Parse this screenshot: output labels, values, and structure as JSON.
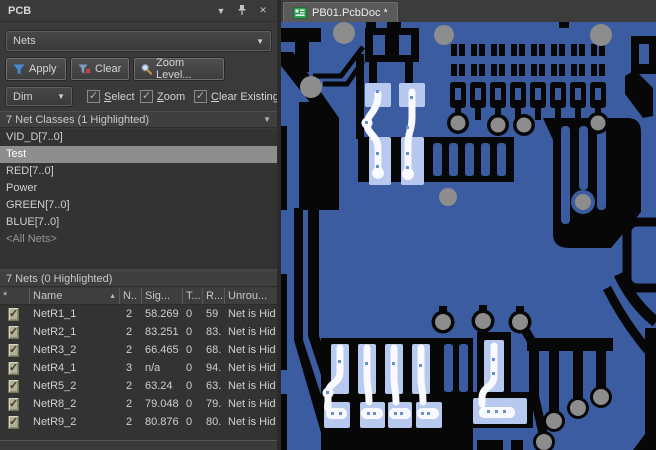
{
  "theme": {
    "panel_bg": "#3a3a3a",
    "panel_text": "#d2d2d2",
    "control_bg": "#454545",
    "control_border": "#6a6a6a",
    "field_bg": "#343434",
    "list_bg": "#333333",
    "header_bg": "#3f3f3f",
    "row_highlight": "#8e8e8e",
    "dim_text": "#969696",
    "table_check_bg": "#b3b196",
    "accent_blue": "#4a8ad4",
    "danger_red": "#d04545",
    "pcb_blue": "#3c5ca2",
    "pcb_black": "#070707",
    "via_gray": "#8d8d8d",
    "hl_pad": "#b7c9ee",
    "hl_trace": "#f8faff",
    "tab_bg": "#3c3c3c",
    "tab_active": "#5a5a5a"
  },
  "panel": {
    "title": "PCB",
    "mode_select": {
      "value": "Nets"
    },
    "buttons": {
      "apply": "Apply",
      "clear": "Clear",
      "zoom_level": "Zoom Level..."
    },
    "dim_select": {
      "value": "Dim"
    },
    "checkboxes": [
      {
        "hotkey": "S",
        "rest": "elect",
        "checked": true
      },
      {
        "hotkey": "Z",
        "rest": "oom",
        "checked": true
      },
      {
        "hotkey": "C",
        "rest": "lear Existing",
        "checked": true
      }
    ],
    "net_classes": {
      "header": "7 Net Classes (1 Highlighted)",
      "items": [
        {
          "name": "VID_D[7..0]"
        },
        {
          "name": "Test",
          "state": "highlighted"
        },
        {
          "name": "RED[7..0]"
        },
        {
          "name": "Power"
        },
        {
          "name": "GREEN[7..0]"
        },
        {
          "name": "BLUE[7..0]"
        },
        {
          "name": "<All Nets>",
          "state": "dim"
        }
      ]
    },
    "nets": {
      "header": "7 Nets (0 Highlighted)",
      "columns": {
        "check": "*",
        "name": "Name",
        "nodes": "N..",
        "signal": "Sig...",
        "t": "T...",
        "routed": "R...",
        "unrouted": "Unrou..."
      },
      "rows": [
        {
          "checked": true,
          "name": "NetR1_1",
          "nodes": "2",
          "signal": "58.269",
          "t": "0",
          "routed": "59",
          "unrouted": "Net is Hid"
        },
        {
          "checked": true,
          "name": "NetR2_1",
          "nodes": "2",
          "signal": "83.251",
          "t": "0",
          "routed": "83.",
          "unrouted": "Net is Hid"
        },
        {
          "checked": true,
          "name": "NetR3_2",
          "nodes": "2",
          "signal": "66.465",
          "t": "0",
          "routed": "68.",
          "unrouted": "Net is Hid"
        },
        {
          "checked": true,
          "name": "NetR4_1",
          "nodes": "3",
          "signal": "n/a",
          "t": "0",
          "routed": "94.",
          "unrouted": "Net is Hid"
        },
        {
          "checked": true,
          "name": "NetR5_2",
          "nodes": "2",
          "signal": "63.24",
          "t": "0",
          "routed": "63.",
          "unrouted": "Net is Hid"
        },
        {
          "checked": true,
          "name": "NetR8_2",
          "nodes": "2",
          "signal": "79.048",
          "t": "0",
          "routed": "79.",
          "unrouted": "Net is Hid"
        },
        {
          "checked": true,
          "name": "NetR9_2",
          "nodes": "2",
          "signal": "80.876",
          "t": "0",
          "routed": "80.",
          "unrouted": "Net is Hid"
        }
      ]
    }
  },
  "editor": {
    "tab": {
      "label": "PB01.PcbDoc *"
    }
  }
}
